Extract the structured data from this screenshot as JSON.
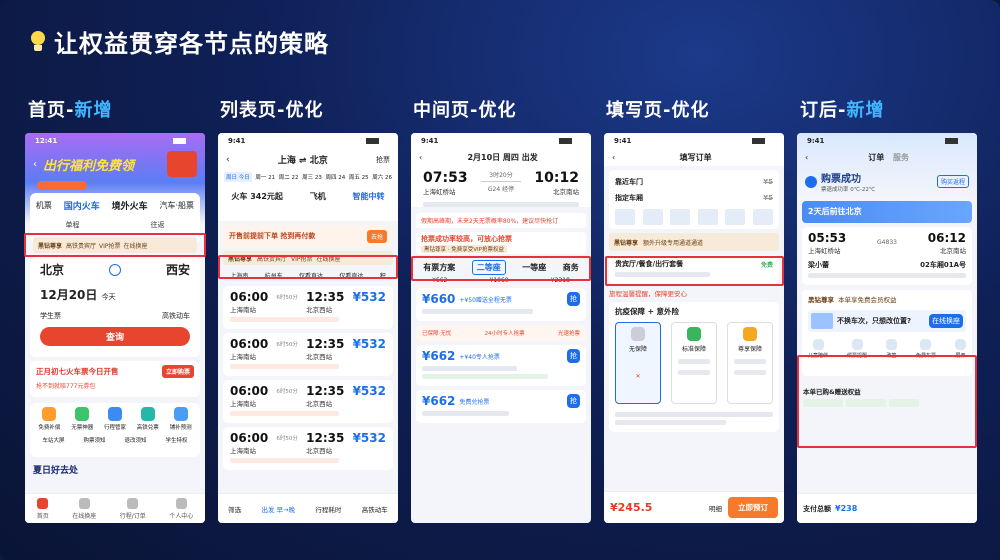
{
  "title": "让权益贯穿各节点的策略",
  "sections": [
    {
      "prefix": "首页-",
      "hl": "新增"
    },
    {
      "prefix": "列表页-优化",
      "hl": ""
    },
    {
      "prefix": "中间页-优化",
      "hl": ""
    },
    {
      "prefix": "填写页-优化",
      "hl": ""
    },
    {
      "prefix": "订后-",
      "hl": "新增"
    }
  ],
  "phone1": {
    "time": "12:41",
    "banner": "出行福利免费领",
    "nav": [
      "机票",
      "国内火车",
      "境外火车",
      "汽车·船票"
    ],
    "subtabs": [
      "单程",
      "往返"
    ],
    "strip": [
      "黑钻尊享",
      "高铁贵宾厅",
      "VIP抢票",
      "在线换座"
    ],
    "from": "北京",
    "to": "西安",
    "date": "12月20日",
    "today": "今天",
    "opt1": "学生票",
    "opt2": "高铁动车",
    "search": "查询",
    "promo": "正月初七火车票今日开售",
    "promo_btn": "立即购票",
    "promo_sub": "抢不到就赔777元券包",
    "icons": [
      "免费补偿",
      "无票神器",
      "行程管家",
      "高铁兑票",
      "铺补预测"
    ],
    "links": [
      "车站大屏",
      "购票须知",
      "退改须知",
      "学生特权"
    ],
    "summer": "夏日好去处",
    "tabs": [
      "首页",
      "在线换座",
      "行程/订单",
      "个人中心"
    ]
  },
  "phone2": {
    "time": "9:41",
    "route_from": "上海",
    "route_to": "北京",
    "filter": "抢票",
    "dates": [
      "周日 今日",
      "周一 21",
      "周二 22",
      "周三 23",
      "周四 24",
      "周五 25",
      "周六 26"
    ],
    "modes": [
      "火车 342元起",
      "飞机",
      "智能中转"
    ],
    "alert": "开售前提前下单 抢到再付款",
    "alert_btn": "去抢",
    "strip": [
      "黑钻尊享",
      "高铁贵宾厅",
      "VIP抢票",
      "在线换座"
    ],
    "stations": [
      "上海南",
      "杭州东",
      "仅看直达",
      "仅看直达",
      "积"
    ],
    "trains": [
      {
        "dep": "06:00",
        "from": "上海南站",
        "dur": "6时50分",
        "arr": "12:35",
        "to": "北京西站",
        "price": "¥532"
      },
      {
        "dep": "06:00",
        "from": "上海南站",
        "dur": "6时50分",
        "arr": "12:35",
        "to": "北京西站",
        "price": "¥532"
      },
      {
        "dep": "06:00",
        "from": "上海南站",
        "dur": "6时50分",
        "arr": "12:35",
        "to": "北京西站",
        "price": "¥532"
      },
      {
        "dep": "06:00",
        "from": "上海南站",
        "dur": "6时50分",
        "arr": "12:35",
        "to": "北京西站",
        "price": "¥532"
      }
    ],
    "bottom": [
      "筛选",
      "出发 早→晚",
      "行程耗时",
      "高铁动车"
    ]
  },
  "phone3": {
    "time": "9:41",
    "date": "2月10日 周四 出发",
    "dep": "07:53",
    "arr": "10:12",
    "from": "上海虹桥站",
    "to": "北京南站",
    "train": "G24 经停",
    "dur": "3时20分",
    "warn": "假期高峰期，未来2天无票概率80%，建议尽快抢订",
    "strip_t": "抢票成功率较高，可放心抢票",
    "strip_s": "黑钻尊享 · 免费享受VIP抢票权益",
    "seats": [
      "有票方案",
      "二等座",
      "一等座",
      "商务"
    ],
    "seat_price": [
      "¥662",
      "¥1060",
      "¥2318"
    ],
    "offers": [
      {
        "price": "¥660",
        "tag": "+¥50赠送全程无票",
        "btn": "抢"
      },
      {
        "price": "¥662",
        "tag": "+¥40专人抢票",
        "btn": "抢"
      },
      {
        "price": "¥662",
        "tag": "免费兑抢票",
        "btn": "抢"
      }
    ],
    "perks": [
      "已保障·无忧",
      "24小时专人抢票",
      "光速抢票"
    ]
  },
  "phone4": {
    "time": "9:41",
    "header": "填写订单",
    "rows": [
      "靠近车门",
      "指定车厢"
    ],
    "strip_t": "黑钻尊享",
    "strip_s": "额外升级专用通道通道",
    "free": "免费",
    "notice": "贵宾厅/餐食/出行套餐",
    "green": "旅程温馨提醒，保障更安心",
    "insure_title": "抗疫保障 + 意外险",
    "plans": [
      "无保障",
      "标准保障",
      "尊享保障"
    ],
    "total": "¥245.5",
    "detail": "明细",
    "submit": "立即预订"
  },
  "phone5": {
    "time": "9:41",
    "tabs": [
      "订单",
      "服务"
    ],
    "status": "购票成功",
    "status_sub": "票退成功率 0℃-22℃",
    "status_btn": "购买返程",
    "banner": "2天后前往北京",
    "dep": "05:53",
    "arr": "06:12",
    "from": "上海虹桥站",
    "to": "北京南站",
    "train": "G4833",
    "passenger": "梁小蕾",
    "seat": "02车厢01A号",
    "strip_t": "黑钻尊享",
    "strip_s": "本单享免费会员权益",
    "upsell": "不换车次，只想改位置?",
    "upsell_btn": "在线换座",
    "icons": [
      "儿童陪伴",
      "候票提醒",
      "改签",
      "免费车票",
      "展开"
    ],
    "extra": "本单已购&赠送权益",
    "total_label": "支付总额",
    "total": "¥238"
  }
}
